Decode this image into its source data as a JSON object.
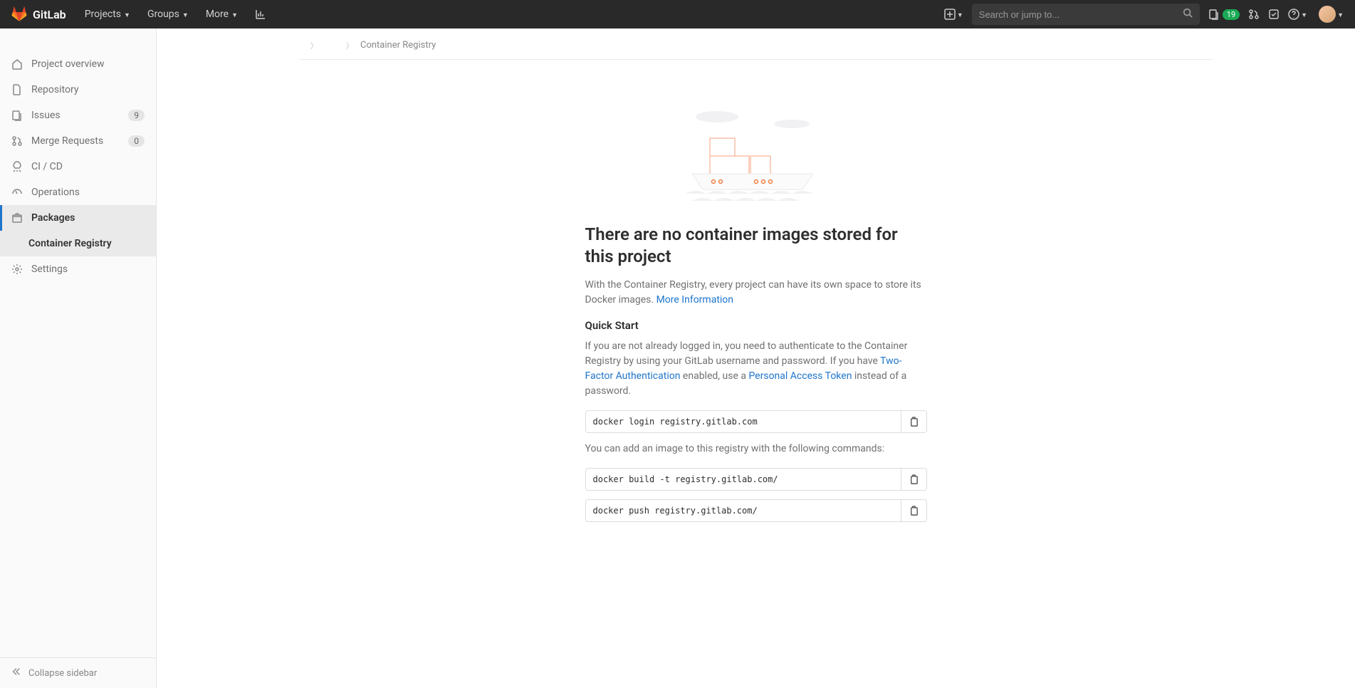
{
  "brand": "GitLab",
  "nav": {
    "projects": "Projects",
    "groups": "Groups",
    "more": "More"
  },
  "search": {
    "placeholder": "Search or jump to..."
  },
  "top_badge": "19",
  "sidebar": {
    "overview": "Project overview",
    "repository": "Repository",
    "issues": "Issues",
    "issues_count": "9",
    "merge_requests": "Merge Requests",
    "mr_count": "0",
    "cicd": "CI / CD",
    "operations": "Operations",
    "packages": "Packages",
    "container_registry": "Container Registry",
    "settings": "Settings",
    "collapse": "Collapse sidebar"
  },
  "breadcrumb": {
    "current": "Container Registry"
  },
  "main": {
    "heading": "There are no container images stored for this project",
    "intro_a": "With the Container Registry, every project can have its own space to store its Docker images. ",
    "intro_link": "More Information",
    "quick_start": "Quick Start",
    "auth_a": "If you are not already logged in, you need to authenticate to the Container Registry by using your GitLab username and password. If you have ",
    "auth_tfa": "Two-Factor Authentication",
    "auth_b": " enabled, use a ",
    "auth_pat": "Personal Access Token",
    "auth_c": " instead of a password.",
    "cmd_login": "docker login registry.gitlab.com",
    "add_image": "You can add an image to this registry with the following commands:",
    "cmd_build": "docker build -t registry.gitlab.com/",
    "cmd_push": "docker push registry.gitlab.com/"
  }
}
